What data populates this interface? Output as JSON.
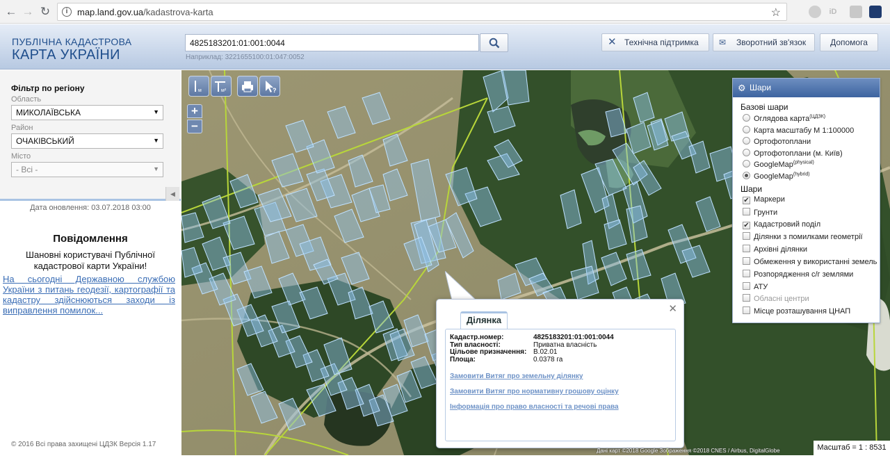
{
  "browser": {
    "url_host": "map.land.gov.ua",
    "url_path": "/kadastrova-karta"
  },
  "header": {
    "logo_line1": "ПУБЛІЧНА КАДАСТРОВА",
    "logo_line2": "КАРТА УКРАЇНИ",
    "search_value": "4825183201:01:001:0044",
    "search_example": "Наприклад: 3221655100:01:047:0052",
    "support_label": "Технічна підтримка",
    "feedback_label": "Зворотний зв'язок",
    "help_label": "Допомога"
  },
  "sidebar": {
    "filter_title": "Фільтр по регіону",
    "oblast_label": "Область",
    "oblast_value": "МИКОЛАЇВСЬКА",
    "raion_label": "Район",
    "raion_value": "ОЧАКІВСЬКИЙ",
    "misto_label": "Місто",
    "misto_value": "- Всі -",
    "updated": "Дата оновлення: 03.07.2018 03:00",
    "message_title": "Повідомлення",
    "message_body": "Шановні користувачі Публічної кадастрової карти України!",
    "message_link": "На сьогодні Державною службою України з питань геодезії, картографії та кадастру здійснюються заходи із виправлення помилок...",
    "copyright": "© 2016 Всі права захищені ЦДЗК Версія 1.17"
  },
  "layers": {
    "title": "Шари",
    "base_title": "Базові шари",
    "base": [
      {
        "label": "Оглядова карта",
        "sup": "(ЦДЗК)",
        "selected": false
      },
      {
        "label": "Карта масштабу М 1:100000",
        "sup": "",
        "selected": false
      },
      {
        "label": "Ортофотоплани",
        "sup": "",
        "selected": false
      },
      {
        "label": "Ортофотоплани (м. Київ)",
        "sup": "",
        "selected": false
      },
      {
        "label": "GoogleMap",
        "sup": "(physical)",
        "selected": false
      },
      {
        "label": "GoogleMap",
        "sup": "(hybrid)",
        "selected": true
      }
    ],
    "overlay_title": "Шари",
    "overlays": [
      {
        "label": "Маркери",
        "checked": true,
        "disabled": false
      },
      {
        "label": "Грунти",
        "checked": false,
        "disabled": false
      },
      {
        "label": "Кадастровий поділ",
        "checked": true,
        "disabled": false
      },
      {
        "label": "Ділянки з помилками геометрії",
        "checked": false,
        "disabled": false
      },
      {
        "label": "Архівні ділянки",
        "checked": false,
        "disabled": false
      },
      {
        "label": "Обмеження у використанні земель",
        "checked": false,
        "disabled": false
      },
      {
        "label": "Розпорядження с/г землями",
        "checked": false,
        "disabled": false
      },
      {
        "label": "АТУ",
        "checked": false,
        "disabled": false
      },
      {
        "label": "Обласні центри",
        "checked": false,
        "disabled": true
      },
      {
        "label": "Місце розташування ЦНАП",
        "checked": false,
        "disabled": false
      }
    ]
  },
  "popup": {
    "tab": "Ділянка",
    "rows": [
      {
        "key": "Кадастр.номер:",
        "value": "4825183201:01:001:0044",
        "bold": true
      },
      {
        "key": "Тип власності:",
        "value": "Приватна власність",
        "bold": false
      },
      {
        "key": "Цільове призначення:",
        "value": "В.02.01",
        "bold": false
      },
      {
        "key": "Площа:",
        "value": "0.0378 га",
        "bold": false
      }
    ],
    "links": [
      "Замовити Витяг про земельну ділянку",
      "Замовити Витяг про нормативну грошову оцінку",
      "Інформація про право власності та речові права"
    ]
  },
  "map": {
    "attribution": "Дані карт ©2018 Google Зображення ©2018 CNES / Airbus, DigitalGlobe",
    "scale": "Масштаб = 1 : 8531",
    "colors": {
      "parcel_fill": "#8fc3ee",
      "parcel_stroke": "#bfe1ff",
      "boundary": "#b8d63a",
      "forest": "#2f4a24",
      "field": "#9a9470"
    }
  }
}
